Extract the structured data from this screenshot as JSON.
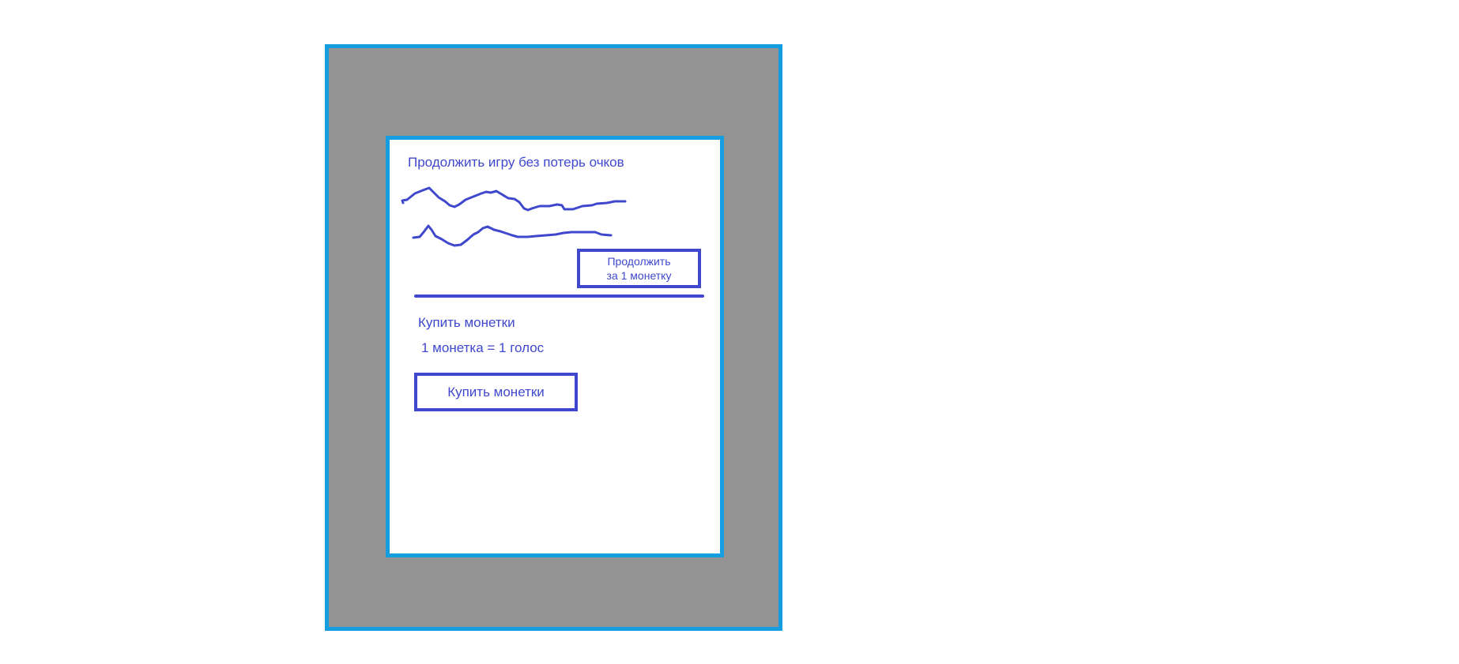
{
  "dialog": {
    "title": "Продолжить игру без потерь очков",
    "continue_button": {
      "line1": "Продолжить",
      "line2": "за 1 монетку"
    },
    "buy_section": {
      "title": "Купить монетки",
      "rate": "1 монетка = 1 голос",
      "button_label": "Купить монетки"
    }
  },
  "colors": {
    "frame_border": "#149ee0",
    "overlay": "#939393",
    "ink": "#3f48cc",
    "dialog_background": "#ffffff"
  }
}
